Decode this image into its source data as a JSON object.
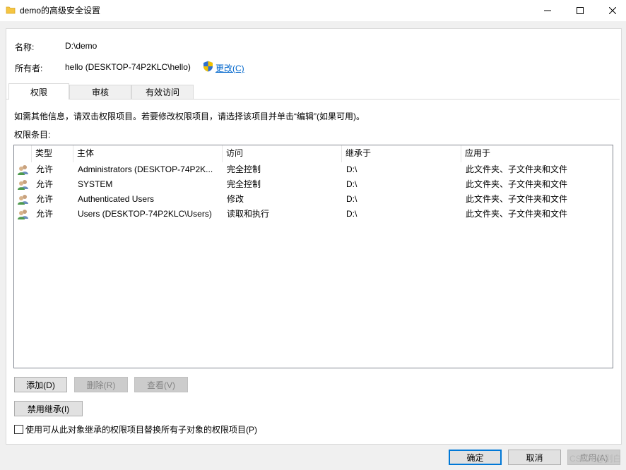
{
  "window": {
    "title": "demo的高级安全设置",
    "folder_icon": "folder-icon",
    "controls": [
      "minimize-icon",
      "maximize-icon",
      "close-icon"
    ]
  },
  "info": {
    "name_label": "名称:",
    "name_value": "D:\\demo",
    "owner_label": "所有者:",
    "owner_value": "hello (DESKTOP-74P2KLC\\hello)",
    "change_link": "更改(C)"
  },
  "tabs": [
    {
      "label": "权限",
      "active": true
    },
    {
      "label": "审核",
      "active": false
    },
    {
      "label": "有效访问",
      "active": false
    }
  ],
  "instructions": "如需其他信息，请双击权限项目。若要修改权限项目，请选择该项目并单击“编辑”(如果可用)。",
  "entries_label": "权限条目:",
  "table": {
    "columns": [
      "类型",
      "主体",
      "访问",
      "继承于",
      "应用于"
    ],
    "rows": [
      {
        "type": "允许",
        "principal": "Administrators (DESKTOP-74P2K...",
        "access": "完全控制",
        "inherited": "D:\\",
        "applies": "此文件夹、子文件夹和文件"
      },
      {
        "type": "允许",
        "principal": "SYSTEM",
        "access": "完全控制",
        "inherited": "D:\\",
        "applies": "此文件夹、子文件夹和文件"
      },
      {
        "type": "允许",
        "principal": "Authenticated Users",
        "access": "修改",
        "inherited": "D:\\",
        "applies": "此文件夹、子文件夹和文件"
      },
      {
        "type": "允许",
        "principal": "Users (DESKTOP-74P2KLC\\Users)",
        "access": "读取和执行",
        "inherited": "D:\\",
        "applies": "此文件夹、子文件夹和文件"
      }
    ]
  },
  "buttons": {
    "add": "添加(D)",
    "remove": "删除(R)",
    "view": "查看(V)",
    "disable_inheritance": "禁用继承(I)",
    "ok": "确定",
    "cancel": "取消",
    "apply": "应用(A)"
  },
  "checkbox_label": "使用可从此对象继承的权限项目替换所有子对象的权限项目(P)",
  "watermark": "CSDN @别白",
  "colors": {
    "accent": "#0078d7",
    "link": "#0066cc",
    "shield_blue": "#2f6fcf",
    "shield_yellow": "#f2c200"
  }
}
